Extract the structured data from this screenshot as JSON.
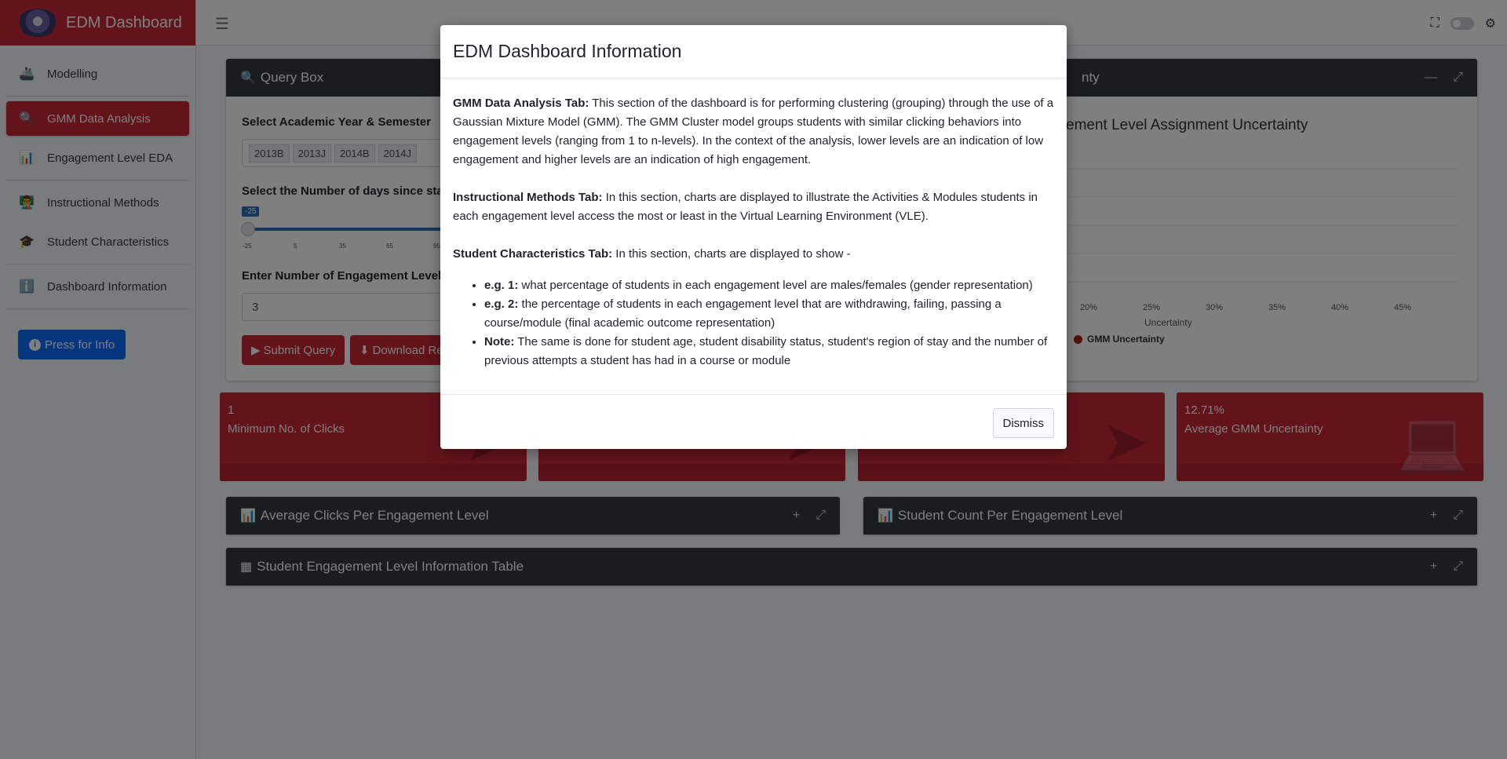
{
  "app": {
    "title": "EDM Dashboard"
  },
  "sidebar": {
    "items": [
      {
        "label": "Modelling",
        "icon": "modelling-icon"
      },
      {
        "label": "GMM Data Analysis",
        "icon": "search-analysis-icon",
        "active": true
      },
      {
        "label": "Engagement Level EDA",
        "icon": "chart-icon"
      },
      {
        "label": "Instructional Methods",
        "icon": "teacher-icon"
      },
      {
        "label": "Student Characteristics",
        "icon": "student-icon"
      },
      {
        "label": "Dashboard Information",
        "icon": "info-icon"
      }
    ],
    "info_button": "Press for Info"
  },
  "query_box": {
    "title": "Query Box",
    "year_label": "Select Academic Year & Semester",
    "semesters": [
      "2013B",
      "2013J",
      "2014B",
      "2014J"
    ],
    "days_label": "Select the Number of days since star",
    "slider_value": "-25",
    "slider_ticks": [
      "-25",
      "5",
      "35",
      "65",
      "95"
    ],
    "levels_label": "Enter Number of Engagement Levels",
    "levels_value": "3",
    "submit_label": "Submit Query",
    "download_label": "Download Re"
  },
  "uncertainty_card": {
    "title_partial": "nty",
    "chart_title_partial": "ement Level Assignment Uncertainty",
    "xlabel": "Uncertainty",
    "xticks": [
      "20%",
      "25%",
      "30%",
      "35%",
      "40%",
      "45%"
    ],
    "legend": "GMM Uncertainty"
  },
  "info_boxes": [
    {
      "value": "1",
      "label": "Minimum No. of Clicks"
    },
    {
      "value": "",
      "label": ""
    },
    {
      "value": "",
      "label": ""
    },
    {
      "value": "12.71%",
      "label": "Average GMM Uncertainty"
    }
  ],
  "panels": {
    "avg_clicks": "Average Clicks Per Engagement Level",
    "student_count": "Student Count Per Engagement Level",
    "info_table": "Student Engagement Level Information Table"
  },
  "modal": {
    "title": "EDM Dashboard Information",
    "gmm_head": "GMM Data Analysis Tab:",
    "gmm_text": " This section of the dashboard is for performing clustering (grouping) through the use of a Gaussian Mixture Model (GMM). The GMM Cluster model groups students with similar clicking behaviors into engagement levels (ranging from 1 to n-levels). In the context of the analysis, lower levels are an indication of low engagement and higher levels are an indication of high engagement.",
    "instr_head": "Instructional Methods Tab:",
    "instr_text": " In this section, charts are displayed to illustrate the Activities & Modules students in each engagement level access the most or least in the Virtual Learning Environment (VLE).",
    "char_head": "Student Characteristics Tab:",
    "char_text": " In this section, charts are displayed to show -",
    "eg1_head": "e.g. 1:",
    "eg1_text": " what percentage of students in each engagement level are males/females (gender representation)",
    "eg2_head": "e.g. 2:",
    "eg2_text": " the percentage of students in each engagement level that are withdrawing, failing, passing a course/module (final academic outcome representation)",
    "note_head": "Note:",
    "note_text": " The same is done for student age, student disability status, student's region of stay and the number of previous attempts a student has had in a course or module",
    "dismiss": "Dismiss"
  }
}
